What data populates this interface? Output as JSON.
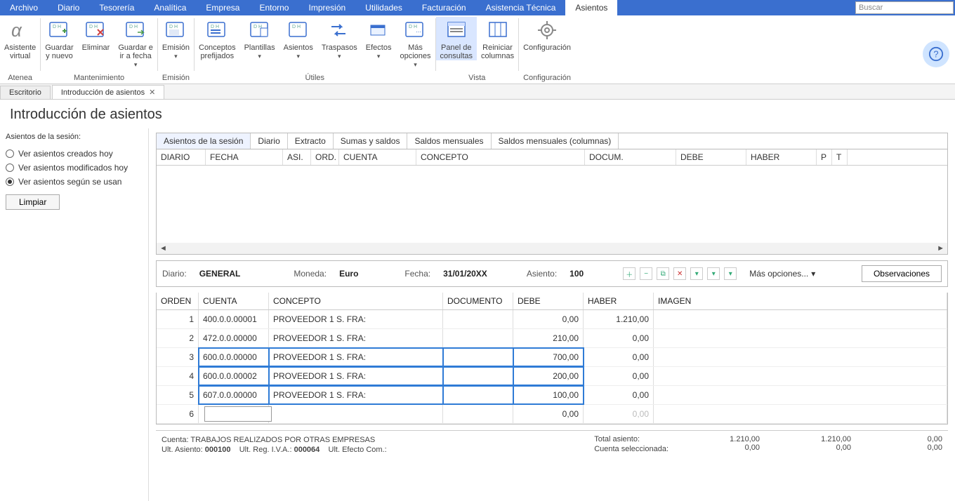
{
  "menu": {
    "items": [
      "Archivo",
      "Diario",
      "Tesorería",
      "Analítica",
      "Empresa",
      "Entorno",
      "Impresión",
      "Utilidades",
      "Facturación",
      "Asistencia Técnica",
      "Asientos"
    ],
    "active": "Asientos",
    "search_placeholder": "Buscar"
  },
  "ribbon": {
    "groups": [
      {
        "name": "Atenea",
        "buttons": [
          {
            "label": "Asistente\nvirtual",
            "icon": "alpha"
          }
        ]
      },
      {
        "name": "Mantenimiento",
        "buttons": [
          {
            "label": "Guardar\ny nuevo",
            "icon": "save-new"
          },
          {
            "label": "Eliminar",
            "icon": "delete"
          },
          {
            "label": "Guardar e\nir a fecha",
            "icon": "save-goto",
            "dd": true
          }
        ]
      },
      {
        "name": "Emisión",
        "buttons": [
          {
            "label": "Emisión",
            "icon": "emit",
            "dd": true
          }
        ]
      },
      {
        "name": "Útiles",
        "buttons": [
          {
            "label": "Conceptos\nprefijados",
            "icon": "concepts"
          },
          {
            "label": "Plantillas",
            "icon": "templates",
            "dd": true
          },
          {
            "label": "Asientos",
            "icon": "entries",
            "dd": true
          },
          {
            "label": "Traspasos",
            "icon": "transfers",
            "dd": true
          },
          {
            "label": "Efectos",
            "icon": "effects",
            "dd": true
          },
          {
            "label": "Más\nopciones",
            "icon": "more",
            "dd": true
          }
        ]
      },
      {
        "name": "Vista",
        "buttons": [
          {
            "label": "Panel de\nconsultas",
            "icon": "panel",
            "active": true
          },
          {
            "label": "Reiniciar\ncolumnas",
            "icon": "reset-cols"
          }
        ]
      },
      {
        "name": "Configuración",
        "buttons": [
          {
            "label": "Configuración",
            "icon": "gear"
          }
        ]
      }
    ]
  },
  "doctabs": [
    {
      "label": "Escritorio",
      "closable": false,
      "front": false
    },
    {
      "label": "Introducción de asientos",
      "closable": true,
      "front": true
    }
  ],
  "page_title": "Introducción de asientos",
  "sidebar": {
    "heading": "Asientos de la sesión:",
    "radios": [
      {
        "label": "Ver asientos creados hoy",
        "selected": false
      },
      {
        "label": "Ver asientos modificados hoy",
        "selected": false
      },
      {
        "label": "Ver asientos según se usan",
        "selected": true
      }
    ],
    "clear_label": "Limpiar"
  },
  "session_tabs": [
    "Asientos de la sesión",
    "Diario",
    "Extracto",
    "Sumas y saldos",
    "Saldos mensuales",
    "Saldos mensuales (columnas)"
  ],
  "session_active": "Asientos de la sesión",
  "session_cols": [
    "DIARIO",
    "FECHA",
    "ASI.",
    "ORD.",
    "CUENTA",
    "CONCEPTO",
    "DOCUM.",
    "DEBE",
    "HABER",
    "P",
    "T"
  ],
  "session_col_widths": [
    70,
    110,
    40,
    40,
    110,
    240,
    130,
    100,
    100,
    22,
    22
  ],
  "entry_header": {
    "diario_label": "Diario:",
    "diario_value": "GENERAL",
    "moneda_label": "Moneda:",
    "moneda_value": "Euro",
    "fecha_label": "Fecha:",
    "fecha_value": "31/01/20XX",
    "asiento_label": "Asiento:",
    "asiento_value": "100",
    "more_opts": "Más opciones...",
    "observaciones": "Observaciones"
  },
  "grid_cols": [
    "ORDEN",
    "CUENTA",
    "CONCEPTO",
    "DOCUMENTO",
    "DEBE",
    "HABER",
    "IMAGEN"
  ],
  "grid_rows": [
    {
      "orden": "1",
      "cuenta": "400.0.0.00001",
      "concepto": "PROVEEDOR 1 S. FRA:",
      "doc": "",
      "debe": "0,00",
      "haber": "1.210,00",
      "sel": false
    },
    {
      "orden": "2",
      "cuenta": "472.0.0.00000",
      "concepto": "PROVEEDOR 1 S. FRA:",
      "doc": "",
      "debe": "210,00",
      "haber": "0,00",
      "sel": false
    },
    {
      "orden": "3",
      "cuenta": "600.0.0.00000",
      "concepto": "PROVEEDOR 1 S. FRA:",
      "doc": "",
      "debe": "700,00",
      "haber": "0,00",
      "sel": true
    },
    {
      "orden": "4",
      "cuenta": "600.0.0.00002",
      "concepto": "PROVEEDOR 1 S. FRA:",
      "doc": "",
      "debe": "200,00",
      "haber": "0,00",
      "sel": true
    },
    {
      "orden": "5",
      "cuenta": "607.0.0.00000",
      "concepto": "PROVEEDOR 1 S. FRA:",
      "doc": "",
      "debe": "100,00",
      "haber": "0,00",
      "sel": true
    },
    {
      "orden": "6",
      "cuenta": "",
      "concepto": "",
      "doc": "",
      "debe": "0,00",
      "haber": "0,00",
      "sel": false,
      "input": true,
      "gray": true
    }
  ],
  "status": {
    "line1_label": "Cuenta:",
    "line1_value": "TRABAJOS REALIZADOS POR OTRAS EMPRESAS",
    "line2_l1": "Ult. Asiento:",
    "line2_v1": "000100",
    "line2_l2": "Ult. Reg. I.V.A.:",
    "line2_v2": "000064",
    "line2_l3": "Ult. Efecto Com.:",
    "total_asiento_label": "Total asiento:",
    "cuenta_sel_label": "Cuenta seleccionada:",
    "cols": [
      [
        "1.210,00",
        "0,00"
      ],
      [
        "1.210,00",
        "0,00"
      ],
      [
        "0,00",
        "0,00"
      ]
    ]
  }
}
